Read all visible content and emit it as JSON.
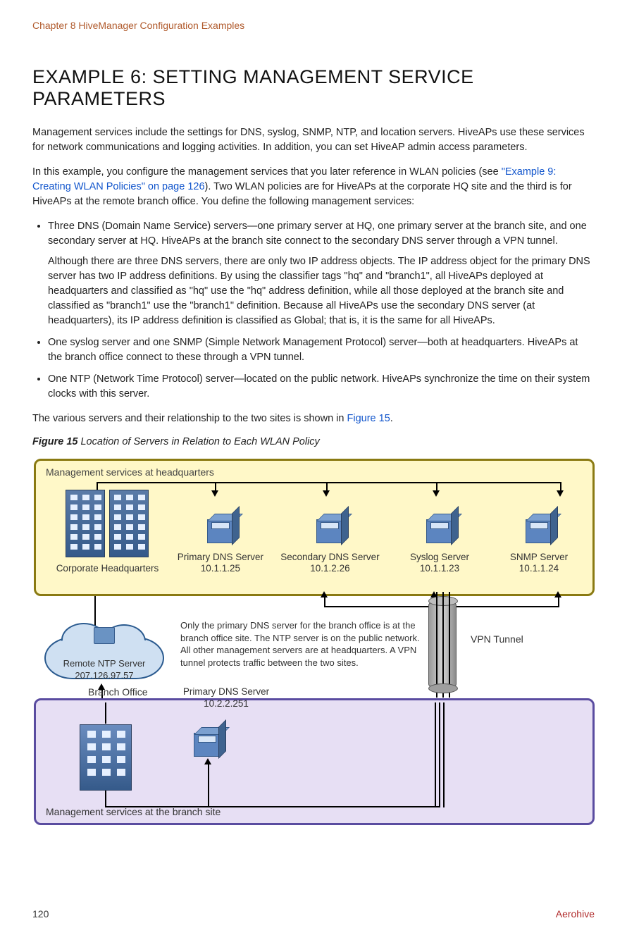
{
  "chapter_header": "Chapter 8 HiveManager Configuration Examples",
  "title_plain": "Example 6: Setting Management Service Parameters",
  "intro_p1": "Management services include the settings for DNS, syslog, SNMP, NTP, and location servers. HiveAPs use these services for network communications and logging activities. In addition, you can set HiveAP admin access parameters.",
  "intro_p2a": "In this example, you configure the management services that you later reference in WLAN policies (see ",
  "intro_link": "\"Example 9: Creating WLAN Policies\" on page 126",
  "intro_p2b": "). Two WLAN policies are for HiveAPs at the corporate HQ site and the third is for HiveAPs at the remote branch office. You define the following management services:",
  "bullets": {
    "b1_main": "Three DNS (Domain Name Service) servers—one primary server at HQ, one primary server at the branch site, and one secondary server at HQ. HiveAPs at the branch site connect to the secondary DNS server through a VPN tunnel.",
    "b1_sub": "Although there are three DNS servers, there are only two IP address objects. The IP address object for the primary DNS server has two IP address definitions. By using the classifier tags \"hq\" and \"branch1\", all HiveAPs deployed at headquarters and classified as \"hq\" use the \"hq\" address definition, while all those deployed at the branch site and classified as \"branch1\" use the \"branch1\" definition. Because all HiveAPs use the secondary DNS server (at headquarters), its IP address definition is classified as Global; that is, it is the same for all HiveAPs.",
    "b2": "One syslog server and one SNMP (Simple Network Management Protocol) server—both at headquarters. HiveAPs at the branch office connect to these through a VPN tunnel.",
    "b3": "One NTP (Network Time Protocol) server—located on the public network. HiveAPs synchronize the time on their system clocks with this server."
  },
  "closing_p_a": "The various servers and their relationship to the two sites is shown in ",
  "closing_link": "Figure 15",
  "closing_p_b": ".",
  "fig_num": "Figure 15",
  "fig_desc": " Location of Servers in Relation to Each WLAN Policy",
  "diagram": {
    "hq_label": "Management services at headquarters",
    "corp_hq": "Corporate Headquarters",
    "primary_dns": {
      "name": "Primary DNS Server",
      "ip": "10.1.1.25"
    },
    "secondary_dns": {
      "name": "Secondary DNS Server",
      "ip": "10.1.2.26"
    },
    "syslog": {
      "name": "Syslog Server",
      "ip": "10.1.1.23"
    },
    "snmp": {
      "name": "SNMP Server",
      "ip": "10.1.1.24"
    },
    "ntp": {
      "name": "Remote NTP Server",
      "ip": "207.126.97.57"
    },
    "mid_note": "Only the primary DNS server for the branch office is at the branch office site. The NTP server is on the public network. All other management servers are at headquarters. A VPN tunnel protects traffic between the two sites.",
    "vpn_label": "VPN Tunnel",
    "branch_office": "Branch Office",
    "branch_primary_dns": {
      "name": "Primary DNS Server",
      "ip": "10.2.2.251"
    },
    "branch_footer": "Management services at the branch site"
  },
  "footer": {
    "page": "120",
    "brand": "Aerohive"
  }
}
